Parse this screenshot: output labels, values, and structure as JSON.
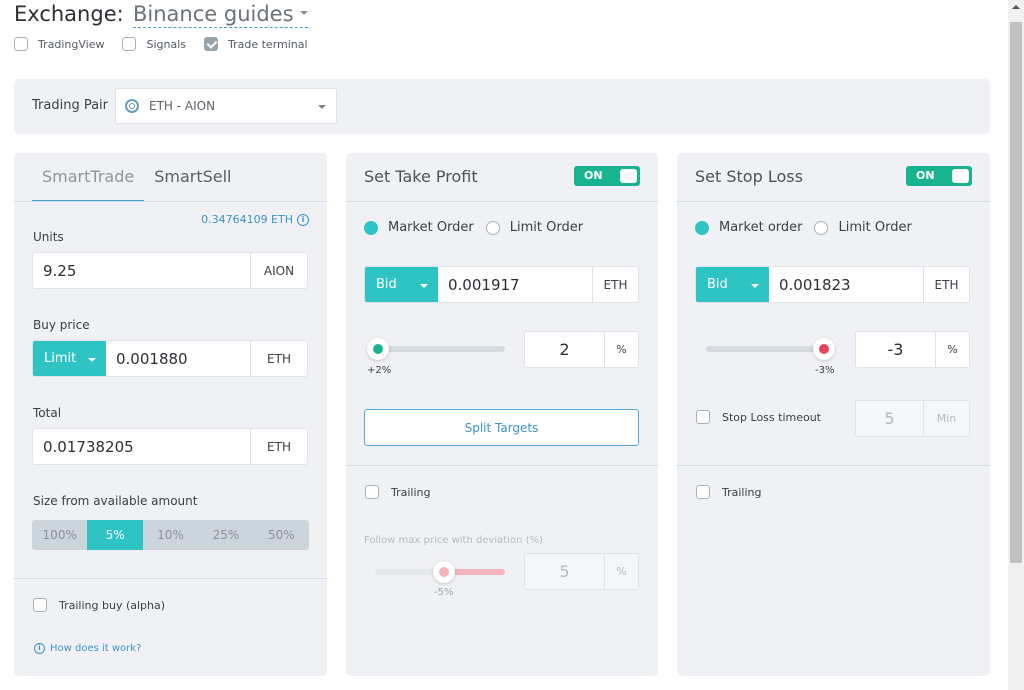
{
  "header": {
    "exchange_label": "Exchange:",
    "exchange_value": "Binance guides",
    "view_options": [
      {
        "label": "TradingView",
        "checked": false
      },
      {
        "label": "Signals",
        "checked": false
      },
      {
        "label": "Trade terminal",
        "checked": true
      }
    ]
  },
  "trading_pair": {
    "label": "Trading Pair",
    "icon": "aion-coin-icon",
    "value": "ETH - AION"
  },
  "smart_trade": {
    "tabs": [
      {
        "label": "SmartTrade",
        "active": true
      },
      {
        "label": "SmartSell",
        "active": false
      }
    ],
    "available_balance": "0.34764109 ETH",
    "units": {
      "label": "Units",
      "value": "9.25",
      "unit": "AION"
    },
    "buy_price": {
      "label": "Buy price",
      "order_type": "Limit",
      "value": "0.001880",
      "unit": "ETH"
    },
    "total": {
      "label": "Total",
      "value": "0.01738205",
      "unit": "ETH"
    },
    "size": {
      "label": "Size from available amount",
      "options": [
        "100%",
        "5%",
        "10%",
        "25%",
        "50%"
      ],
      "selected": "5%"
    },
    "trailing_buy": {
      "label": "Trailing buy (alpha)",
      "checked": false
    },
    "help_link": "How does it work?"
  },
  "take_profit": {
    "title": "Set Take Profit",
    "toggle": "ON",
    "order_types": [
      {
        "label": "Market Order",
        "selected": true
      },
      {
        "label": "Limit Order",
        "selected": false
      }
    ],
    "price_source": "Bid",
    "price": "0.001917",
    "price_unit": "ETH",
    "percent": "2",
    "percent_unit": "%",
    "slider_tip": "+2%",
    "slider_value_percent": 2,
    "split_targets": "Split Targets",
    "trailing": {
      "label": "Trailing",
      "checked": false
    },
    "follow_label": "Follow max price with deviation (%)",
    "deviation": "5",
    "deviation_unit": "%",
    "deviation_tip": "-5%",
    "deviation_slider_value_percent": -5
  },
  "stop_loss": {
    "title": "Set Stop Loss",
    "toggle": "ON",
    "order_types": [
      {
        "label": "Market order",
        "selected": true
      },
      {
        "label": "Limit Order",
        "selected": false
      }
    ],
    "price_source": "Bid",
    "price": "0.001823",
    "price_unit": "ETH",
    "percent": "-3",
    "percent_unit": "%",
    "slider_tip": "-3%",
    "slider_value_percent": -3,
    "timeout": {
      "label": "Stop Loss timeout",
      "checked": false,
      "value": "5",
      "unit": "Min"
    },
    "trailing": {
      "label": "Trailing",
      "checked": false
    }
  },
  "colors": {
    "accent": "#2ec4c3",
    "toggle_on": "#18b48f",
    "link": "#3e93c7",
    "loss": "#e8455a",
    "panel_bg": "#f0f1f4"
  }
}
